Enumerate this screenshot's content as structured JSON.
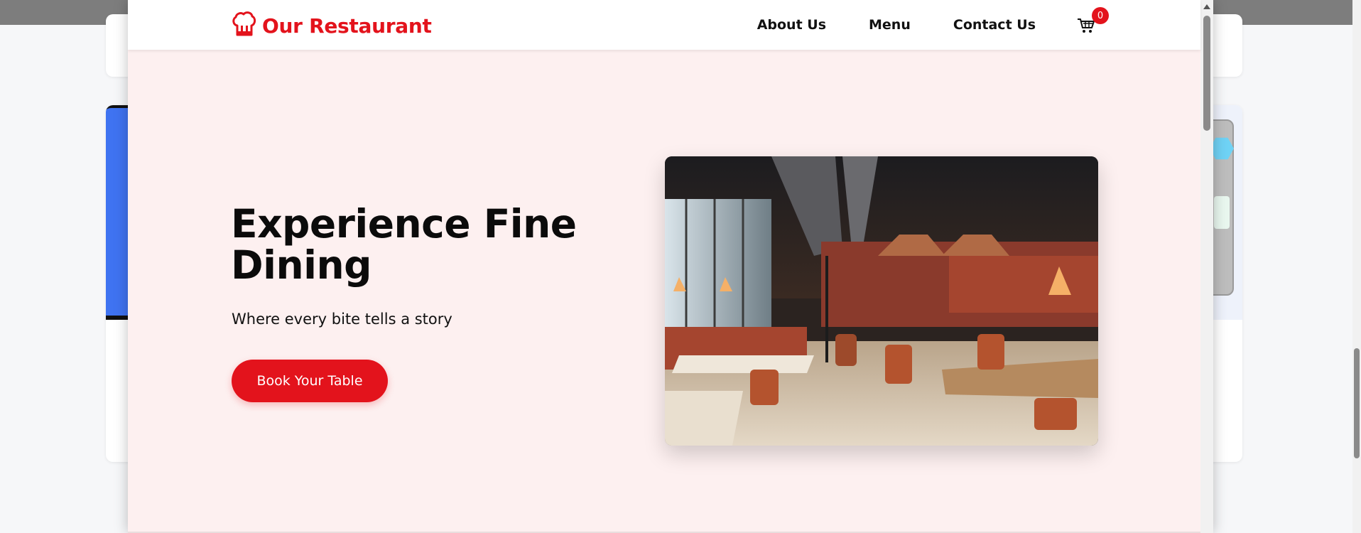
{
  "brand": {
    "title": "Our Restaurant",
    "logo_icon": "chef-hat-icon",
    "accent_color": "#e3131c"
  },
  "nav": {
    "items": [
      {
        "label": "About Us"
      },
      {
        "label": "Menu"
      },
      {
        "label": "Contact Us"
      }
    ]
  },
  "cart": {
    "icon": "shopping-cart-icon",
    "count": "0"
  },
  "hero": {
    "title": "Experience Fine Dining",
    "subtitle": "Where every bite tells a story",
    "cta_label": "Book Your Table",
    "image_alt": "restaurant interior",
    "background_color": "#fdf0f0"
  }
}
